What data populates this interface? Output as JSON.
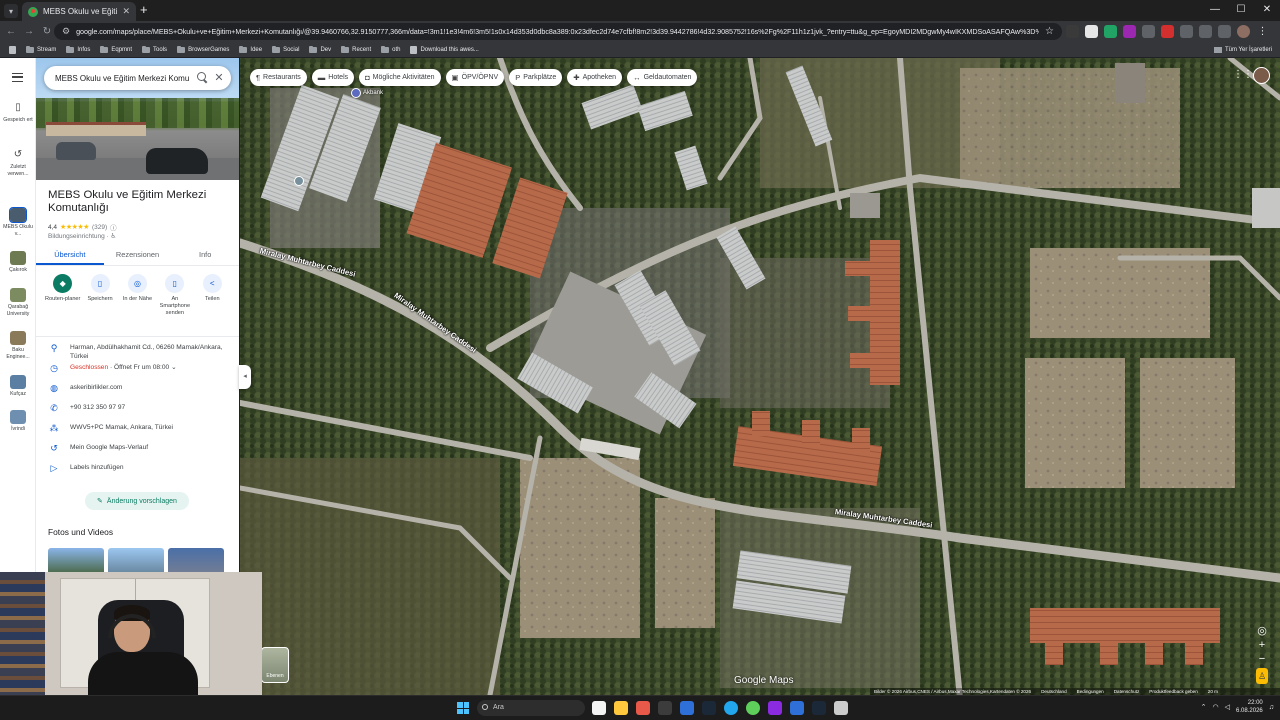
{
  "browser": {
    "tab_title": "MEBS Okulu ve Eğitim Merkezi",
    "url": "google.com/maps/place/MEBS+Okulu+ve+Eğitim+Merkezi+Komutanlığı/@39.9460766,32.9150777,366m/data=!3m1!1e3!4m6!3m5!1s0x14d353d0dbc8a389:0x23dfec2d74e7cfbf!8m2!3d39.9442786!4d32.9085752!16s%2Fg%2F11h1z1jvk_?entry=ttu&g_ep=EgoyMDI2MDgwMy4wIKXMDSoASAFQAw%3D%3D",
    "bookmarks": [
      "Stream",
      "Infos",
      "Eqpmnt",
      "Tools",
      "BrowserGames",
      "Idee",
      "Social",
      "Dev",
      "Recent",
      "oth",
      "Download this awes..."
    ],
    "all_bookmarks": "Tüm Yer İşaretleri"
  },
  "rail": {
    "items": [
      {
        "label": "Gespeich ert",
        "icon": "bookmark-icon"
      },
      {
        "label": "Zuletzt verwen...",
        "icon": "history-icon"
      },
      {
        "label": "MEBS Okulu v...",
        "icon": "thumb"
      },
      {
        "label": "Çakırok",
        "icon": "thumb"
      },
      {
        "label": "Qarabağ University",
        "icon": "thumb"
      },
      {
        "label": "Baku Enginee...",
        "icon": "thumb"
      },
      {
        "label": "Kufçaz",
        "icon": "thumb"
      },
      {
        "label": "İvrindi",
        "icon": "thumb"
      }
    ]
  },
  "panel": {
    "search_query": "MEBS Okulu ve Eğitim Merkezi Komutanlığı",
    "title": "MEBS Okulu ve Eğitim Merkezi Komutanlığı",
    "rating": "4,4",
    "stars": "★★★★★",
    "reviews": "(329)",
    "category": "Bildungseinrichtung · ♿",
    "tabs": [
      "Übersicht",
      "Rezensionen",
      "Info"
    ],
    "actions": [
      {
        "label": "Routen-planer",
        "icon": "directions-icon",
        "glyph": "◆"
      },
      {
        "label": "Speichern",
        "icon": "save-icon",
        "glyph": "▯"
      },
      {
        "label": "In der Nähe",
        "icon": "nearby-icon",
        "glyph": "◎"
      },
      {
        "label": "An Smartphone senden",
        "icon": "phone-icon",
        "glyph": "▯"
      },
      {
        "label": "Teilen",
        "icon": "share-icon",
        "glyph": "<"
      }
    ],
    "info": {
      "address": "Harman, Abdülhakhamit Cd., 06260 Mamak/Ankara, Türkei",
      "hours_closed": "Geschlossen",
      "hours_next": " · Öffnet Fr um 08:00",
      "website": "askeribirlikler.com",
      "phone": "+90 312 350 97 97",
      "plus_code": "WWV5+PC Mamak, Ankara, Türkei",
      "history": "Mein Google Maps-Verlauf",
      "labels": "Labels hinzufügen"
    },
    "suggest_edit": "Änderung vorschlagen",
    "photos_title": "Fotos und Videos"
  },
  "map": {
    "chips": [
      {
        "label": "Restaurants",
        "icon": "fork-knife-icon",
        "glyph": "¶"
      },
      {
        "label": "Hotels",
        "icon": "bed-icon",
        "glyph": "▬"
      },
      {
        "label": "Mögliche Aktivitäten",
        "icon": "camera-icon",
        "glyph": "◘"
      },
      {
        "label": "ÖPV/ÖPNV",
        "icon": "transit-icon",
        "glyph": "▣"
      },
      {
        "label": "Parkplätze",
        "icon": "parking-icon",
        "glyph": "P"
      },
      {
        "label": "Apotheken",
        "icon": "pharmacy-icon",
        "glyph": "✚"
      },
      {
        "label": "Geldautomaten",
        "icon": "atm-icon",
        "glyph": "↔"
      }
    ],
    "road_label_1": "Miralay Muhtarbey Caddesi",
    "road_label_2": "Miralay Muhtarbey Caddesi",
    "road_label_3": "Miralay Muhtarbey Caddesi",
    "poi_label": "Akbank",
    "google_logo": "Google Maps",
    "layers_label": "Ebenen",
    "attribution": [
      "Bilder © 2026 Airbus,CNES / Airbus,Maxar Technologies,Kartendaten © 2026",
      "Deutschland",
      "Bedingungen",
      "Datenschutz",
      "Produktfeedback geben",
      "20 m"
    ]
  },
  "taskbar": {
    "search_placeholder": "Ara",
    "time": "22:00",
    "date": "6.08.2026",
    "apps": [
      "#f4f4f4",
      "#ffc83d",
      "#e8594a",
      "#3c3c3c",
      "#2e6fd8",
      "#1b2838",
      "#22a6ee",
      "#5ecf5a",
      "#8a2be2",
      "#2e6fd8",
      "#1b2838",
      "#cccccc"
    ]
  },
  "colors": {
    "accent_blue": "#0b57d0",
    "accent_green": "#0b7c63",
    "closed_red": "#d93025",
    "star_yellow": "#fbbc04"
  }
}
